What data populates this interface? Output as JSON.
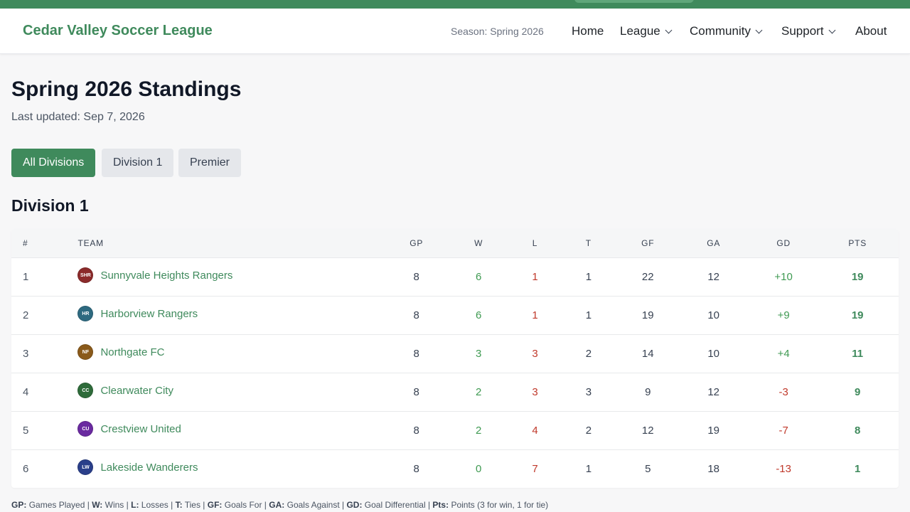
{
  "colors": {
    "brand": "#3f8a5c",
    "positive": "#3f9a52",
    "negative": "#c0392b",
    "badge_shr": "#8b2a2a",
    "badge_hr": "#2e6a80",
    "badge_nf": "#8a5a1a",
    "badge_cc": "#2e6b3a",
    "badge_cu": "#6a2aa0",
    "badge_lw": "#2a3f8a"
  },
  "navbar": {
    "brand": "Cedar Valley Soccer League",
    "season": "Season: Spring 2026",
    "items": [
      "Home",
      "League",
      "Community",
      "Support",
      "About"
    ]
  },
  "page": {
    "title": "Spring 2026 Standings",
    "updated": "Last updated: Sep 7, 2026"
  },
  "filters": [
    "All Divisions",
    "Division 1",
    "Premier"
  ],
  "section": {
    "title": "Division 1"
  },
  "table": {
    "headers": [
      "#",
      "TEAM",
      "GP",
      "W",
      "L",
      "T",
      "GF",
      "GA",
      "GD",
      "PTS"
    ],
    "rows": [
      {
        "rank": "1",
        "abbr": "SHR",
        "team": "Sunnyvale Heights Rangers",
        "gp": "8",
        "w": "6",
        "l": "1",
        "t": "1",
        "gf": "22",
        "ga": "12",
        "gd": "+10",
        "pts": "19"
      },
      {
        "rank": "2",
        "abbr": "HR",
        "team": "Harborview Rangers",
        "gp": "8",
        "w": "6",
        "l": "1",
        "t": "1",
        "gf": "19",
        "ga": "10",
        "gd": "+9",
        "pts": "19"
      },
      {
        "rank": "3",
        "abbr": "NF",
        "team": "Northgate FC",
        "gp": "8",
        "w": "3",
        "l": "3",
        "t": "2",
        "gf": "14",
        "ga": "10",
        "gd": "+4",
        "pts": "11"
      },
      {
        "rank": "4",
        "abbr": "CC",
        "team": "Clearwater City",
        "gp": "8",
        "w": "2",
        "l": "3",
        "t": "3",
        "gf": "9",
        "ga": "12",
        "gd": "-3",
        "pts": "9"
      },
      {
        "rank": "5",
        "abbr": "CU",
        "team": "Crestview United",
        "gp": "8",
        "w": "2",
        "l": "4",
        "t": "2",
        "gf": "12",
        "ga": "19",
        "gd": "-7",
        "pts": "8"
      },
      {
        "rank": "6",
        "abbr": "LW",
        "team": "Lakeside Wanderers",
        "gp": "8",
        "w": "0",
        "l": "7",
        "t": "1",
        "gf": "5",
        "ga": "18",
        "gd": "-13",
        "pts": "1"
      }
    ]
  },
  "legend": [
    {
      "k": "GP:",
      "v": "Games Played"
    },
    {
      "k": "W:",
      "v": "Wins"
    },
    {
      "k": "L:",
      "v": "Losses"
    },
    {
      "k": "T:",
      "v": "Ties"
    },
    {
      "k": "GF:",
      "v": "Goals For"
    },
    {
      "k": "GA:",
      "v": "Goals Against"
    },
    {
      "k": "GD:",
      "v": "Goal Differential"
    },
    {
      "k": "Pts:",
      "v": "Points (3 for win, 1 for tie)"
    }
  ]
}
